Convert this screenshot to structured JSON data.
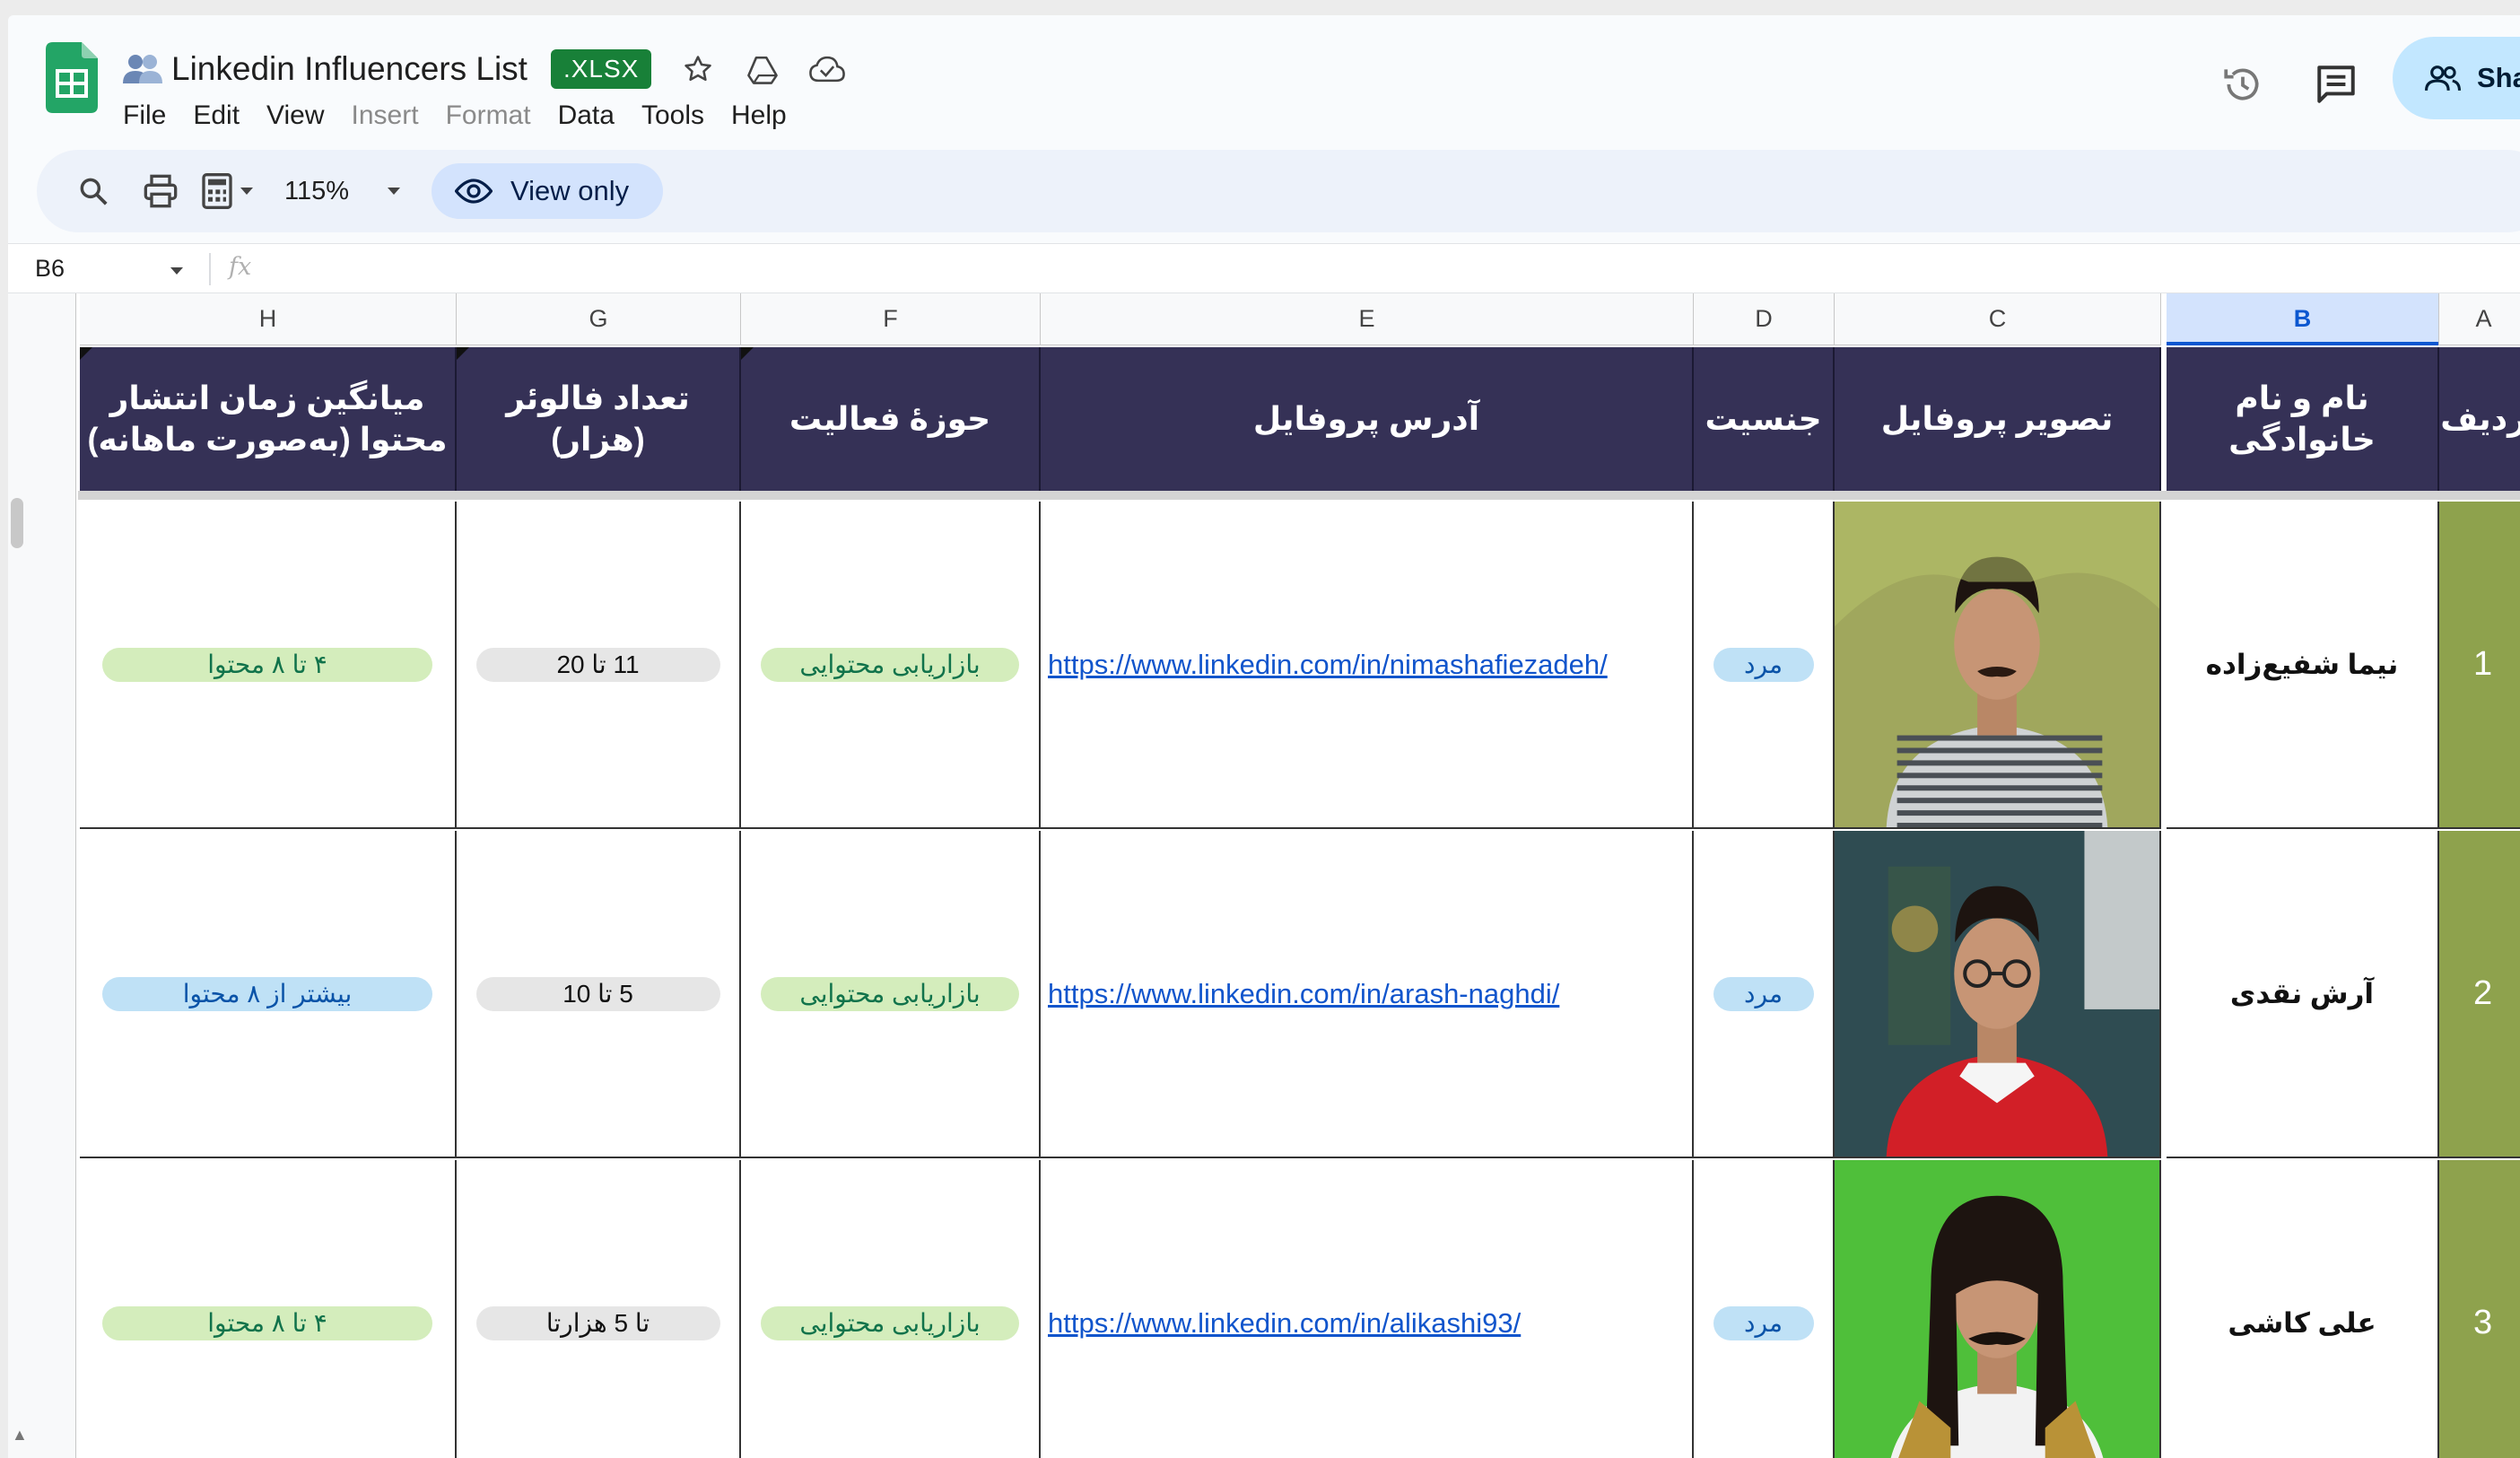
{
  "doc": {
    "title": "Linkedin Influencers List",
    "badge": ".XLSX",
    "icons": [
      "people-icon",
      "star-icon",
      "move-to-drive-icon",
      "cloud-saved-icon"
    ]
  },
  "menu": [
    {
      "label": "File",
      "disabled": false
    },
    {
      "label": "Edit",
      "disabled": false
    },
    {
      "label": "View",
      "disabled": false
    },
    {
      "label": "Insert",
      "disabled": true
    },
    {
      "label": "Format",
      "disabled": true
    },
    {
      "label": "Data",
      "disabled": false
    },
    {
      "label": "Tools",
      "disabled": false
    },
    {
      "label": "Help",
      "disabled": false
    }
  ],
  "share": {
    "label": "Sha"
  },
  "toolbar": {
    "zoom": "115%",
    "view_only": "View only"
  },
  "formula": {
    "cell_ref": "B6",
    "fx": "fx"
  },
  "columns": [
    "H",
    "G",
    "F",
    "E",
    "D",
    "C",
    "B",
    "A"
  ],
  "headers": {
    "h": "میانگین زمان انتشار محتوا (به‌صورت ماهانه)",
    "g": "تعداد فالوئر (هزار)",
    "f": "حوزهٔ فعالیت",
    "e": "آدرس پروفایل",
    "d": "جنسیت",
    "c": "تصویر پروفایل",
    "b": "نام و نام خانوادگی",
    "a": "ردیف"
  },
  "rows": [
    {
      "num": "1",
      "name": "نیما شفیع‌زاده",
      "gender": "مرد",
      "url": "https://www.linkedin.com/in/nimashafiezadeh/",
      "field": "بازاریابی محتوایی",
      "followers": "11 تا 20",
      "frequency": "۴ تا ۸ محتوا",
      "frequency_color": "green",
      "photo_bg": "#8a9a4e"
    },
    {
      "num": "2",
      "name": "آرش نقدی",
      "gender": "مرد",
      "url": "https://www.linkedin.com/in/arash-naghdi/",
      "field": "بازاریابی محتوایی",
      "followers": "5 تا 10",
      "frequency": "بیشتر از ۸ محتوا",
      "frequency_color": "blue",
      "photo_bg": "#2f4c52"
    },
    {
      "num": "3",
      "name": "علی کاشی",
      "gender": "مرد",
      "url": "https://www.linkedin.com/in/alikashi93/",
      "field": "بازاریابی محتوایی",
      "followers": "تا 5 هزارتا",
      "frequency": "۴ تا ۸ محتوا",
      "frequency_color": "green",
      "photo_bg": "#4fbf3a"
    }
  ],
  "colors": {
    "header_bg": "#353156",
    "row_number_bg": "#8ea24d",
    "xlsx_badge": "#188038",
    "share_bg": "#c2e7ff",
    "view_only_bg": "#d3e3fd"
  }
}
